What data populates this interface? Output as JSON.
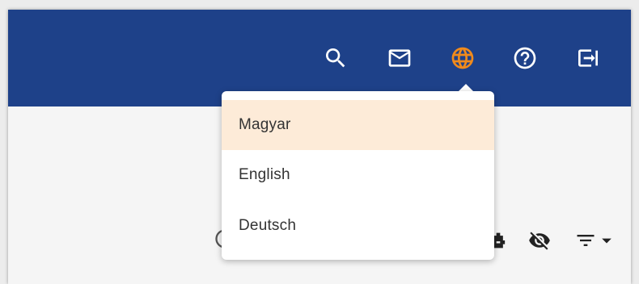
{
  "header": {
    "icons": [
      {
        "name": "search-icon"
      },
      {
        "name": "mail-icon"
      },
      {
        "name": "globe-icon",
        "active": true
      },
      {
        "name": "help-icon"
      },
      {
        "name": "logout-icon"
      }
    ]
  },
  "language_menu": {
    "items": [
      {
        "label": "Magyar",
        "selected": true
      },
      {
        "label": "English",
        "selected": false
      },
      {
        "label": "Deutsch",
        "selected": false
      }
    ]
  },
  "toolbar": {
    "icons": [
      "robot-icon",
      "visibility-off-icon",
      "filter-icon",
      "dropdown-arrow-icon"
    ]
  },
  "colors": {
    "header_bg": "#1e4189",
    "active_icon": "#f08a1c",
    "selected_item_bg": "#fdebd8",
    "content_bg": "#f5f5f5"
  }
}
